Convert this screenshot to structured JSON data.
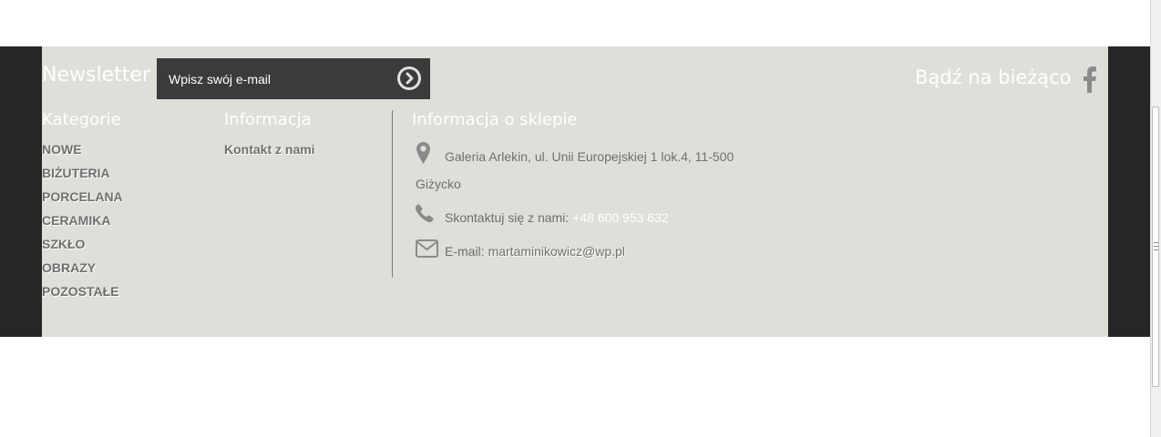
{
  "newsletter": {
    "title": "Newsletter",
    "email_placeholder": "Wpisz swój e-mail",
    "submit_icon": "arrow-right-circle-icon"
  },
  "social": {
    "title": "Bądź na bieżąco",
    "facebook_icon": "facebook-icon"
  },
  "categories": {
    "title": "Kategorie",
    "items": [
      {
        "label": "NOWE"
      },
      {
        "label": "BIŻUTERIA"
      },
      {
        "label": "PORCELANA"
      },
      {
        "label": "CERAMIKA"
      },
      {
        "label": "SZKŁO"
      },
      {
        "label": "OBRAZY"
      },
      {
        "label": "POZOSTAŁE"
      }
    ]
  },
  "information": {
    "title": "Informacja",
    "contact_link": "Kontakt z nami"
  },
  "store_info": {
    "title": "Informacja o sklepie",
    "address_line1": "Galeria Arlekin, ul. Unii Europejskiej 1 lok.4, 11-500",
    "address_line2": "Giżycko",
    "phone_label": "Skontaktuj się z nami:",
    "phone_value": "+48 600 953 632",
    "email_label": "E-mail:",
    "email_value": "martaminikowicz@wp.pl",
    "icons": [
      "map-marker-icon",
      "phone-icon",
      "envelope-icon"
    ]
  },
  "colors": {
    "footer_bg": "#dfded9",
    "band_bg": "#262626",
    "newsletter_box": "#3b3b3b",
    "heading_text": "#ffffff",
    "link_text": "#6f6f6f"
  }
}
